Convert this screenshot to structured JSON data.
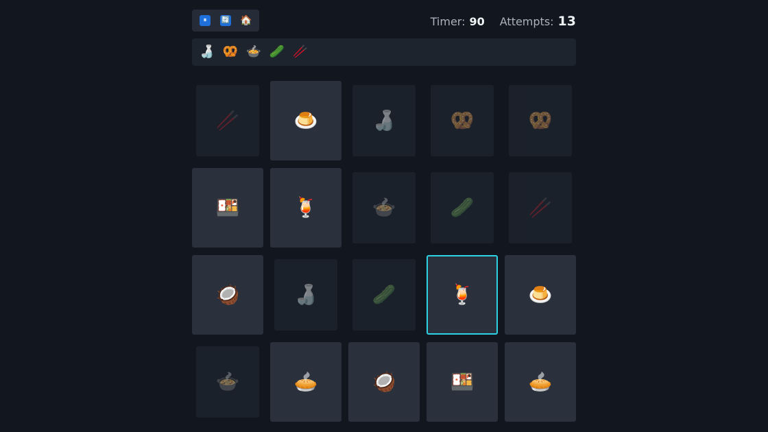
{
  "controls": {
    "pause": "⏸",
    "restart": "🔄",
    "home": "🏠"
  },
  "stats": {
    "timer_label": "Timer:",
    "timer_value": "90",
    "attempts_label": "Attempts:",
    "attempts_value": "13"
  },
  "tray": [
    "🍶",
    "🥨",
    "🍲",
    "🥒",
    "🥢"
  ],
  "board": [
    [
      {
        "emoji": "🥢",
        "state": "matched"
      },
      {
        "emoji": "🍮",
        "state": "up"
      },
      {
        "emoji": "🍶",
        "state": "matched"
      },
      {
        "emoji": "🥨",
        "state": "matched"
      },
      {
        "emoji": "🥨",
        "state": "matched"
      }
    ],
    [
      {
        "emoji": "🍱",
        "state": "up"
      },
      {
        "emoji": "🍹",
        "state": "up"
      },
      {
        "emoji": "🍲",
        "state": "matched"
      },
      {
        "emoji": "🥒",
        "state": "matched"
      },
      {
        "emoji": "🥢",
        "state": "matched"
      }
    ],
    [
      {
        "emoji": "🥥",
        "state": "up"
      },
      {
        "emoji": "🍶",
        "state": "matched"
      },
      {
        "emoji": "🥒",
        "state": "matched"
      },
      {
        "emoji": "🍹",
        "state": "selected"
      },
      {
        "emoji": "🍮",
        "state": "up"
      }
    ],
    [
      {
        "emoji": "🍲",
        "state": "matched"
      },
      {
        "emoji": "🥧",
        "state": "up"
      },
      {
        "emoji": "🥥",
        "state": "up"
      },
      {
        "emoji": "🍱",
        "state": "up"
      },
      {
        "emoji": "🥧",
        "state": "up"
      }
    ]
  ]
}
